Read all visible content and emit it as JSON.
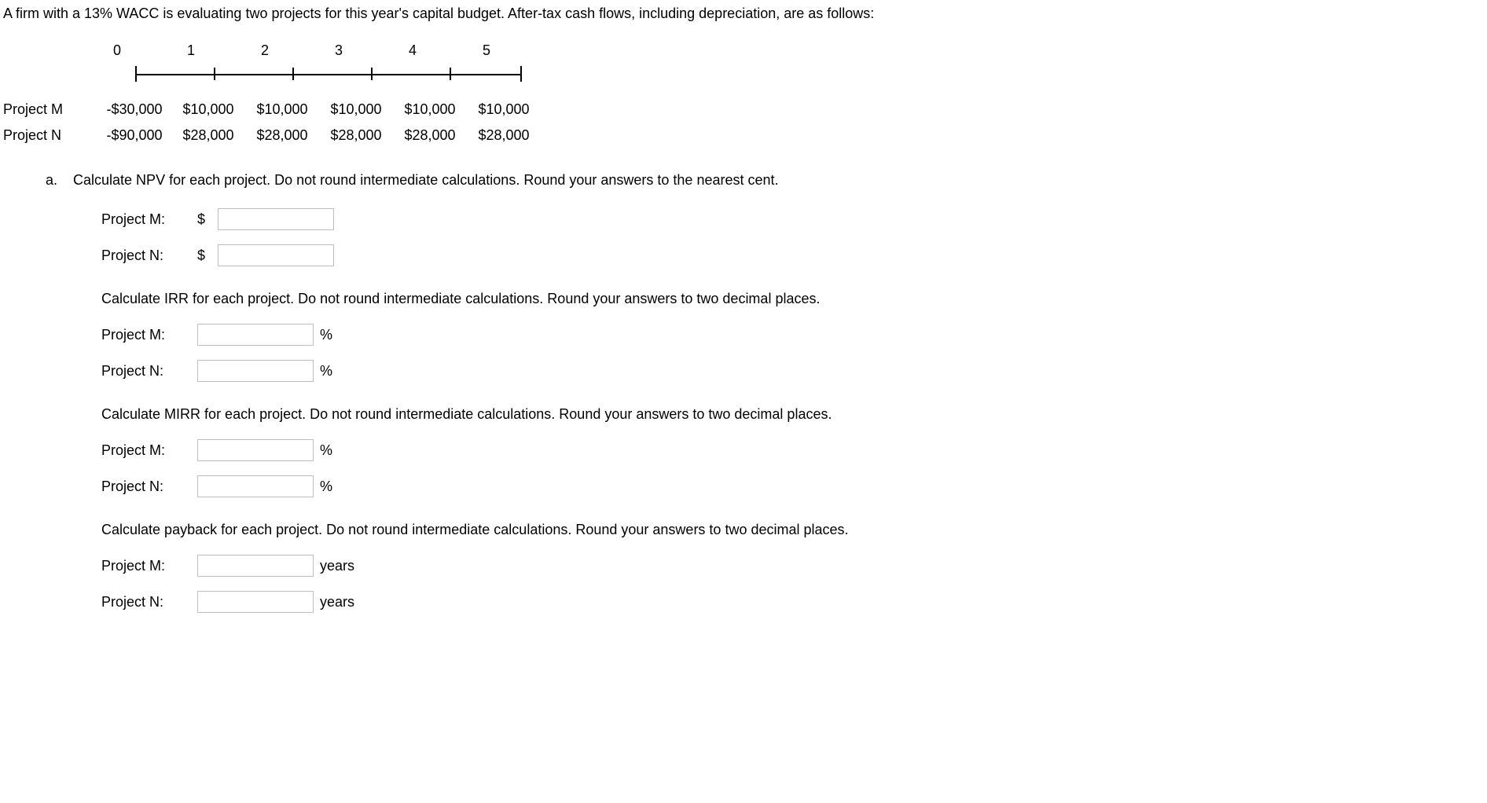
{
  "intro": "A firm with a 13% WACC is evaluating two projects for this year's capital budget. After-tax cash flows, including depreciation, are as follows:",
  "periods": [
    "0",
    "1",
    "2",
    "3",
    "4",
    "5"
  ],
  "projects": {
    "m": {
      "label": "Project M",
      "flows": [
        "-$30,000",
        "$10,000",
        "$10,000",
        "$10,000",
        "$10,000",
        "$10,000"
      ]
    },
    "n": {
      "label": "Project N",
      "flows": [
        "-$90,000",
        "$28,000",
        "$28,000",
        "$28,000",
        "$28,000",
        "$28,000"
      ]
    }
  },
  "q": {
    "letter": "a.",
    "npv": {
      "text": "Calculate NPV for each project. Do not round intermediate calculations. Round your answers to the nearest cent.",
      "m_label": "Project M:",
      "n_label": "Project N:",
      "prefix": "$"
    },
    "irr": {
      "text": "Calculate IRR for each project. Do not round intermediate calculations. Round your answers to two decimal places.",
      "m_label": "Project M:",
      "n_label": "Project N:",
      "suffix": "%"
    },
    "mirr": {
      "text": "Calculate MIRR for each project. Do not round intermediate calculations. Round your answers to two decimal places.",
      "m_label": "Project M:",
      "n_label": "Project N:",
      "suffix": "%"
    },
    "payback": {
      "text": "Calculate payback for each project. Do not round intermediate calculations. Round your answers to two decimal places.",
      "m_label": "Project M:",
      "n_label": "Project N:",
      "suffix": "years"
    }
  }
}
